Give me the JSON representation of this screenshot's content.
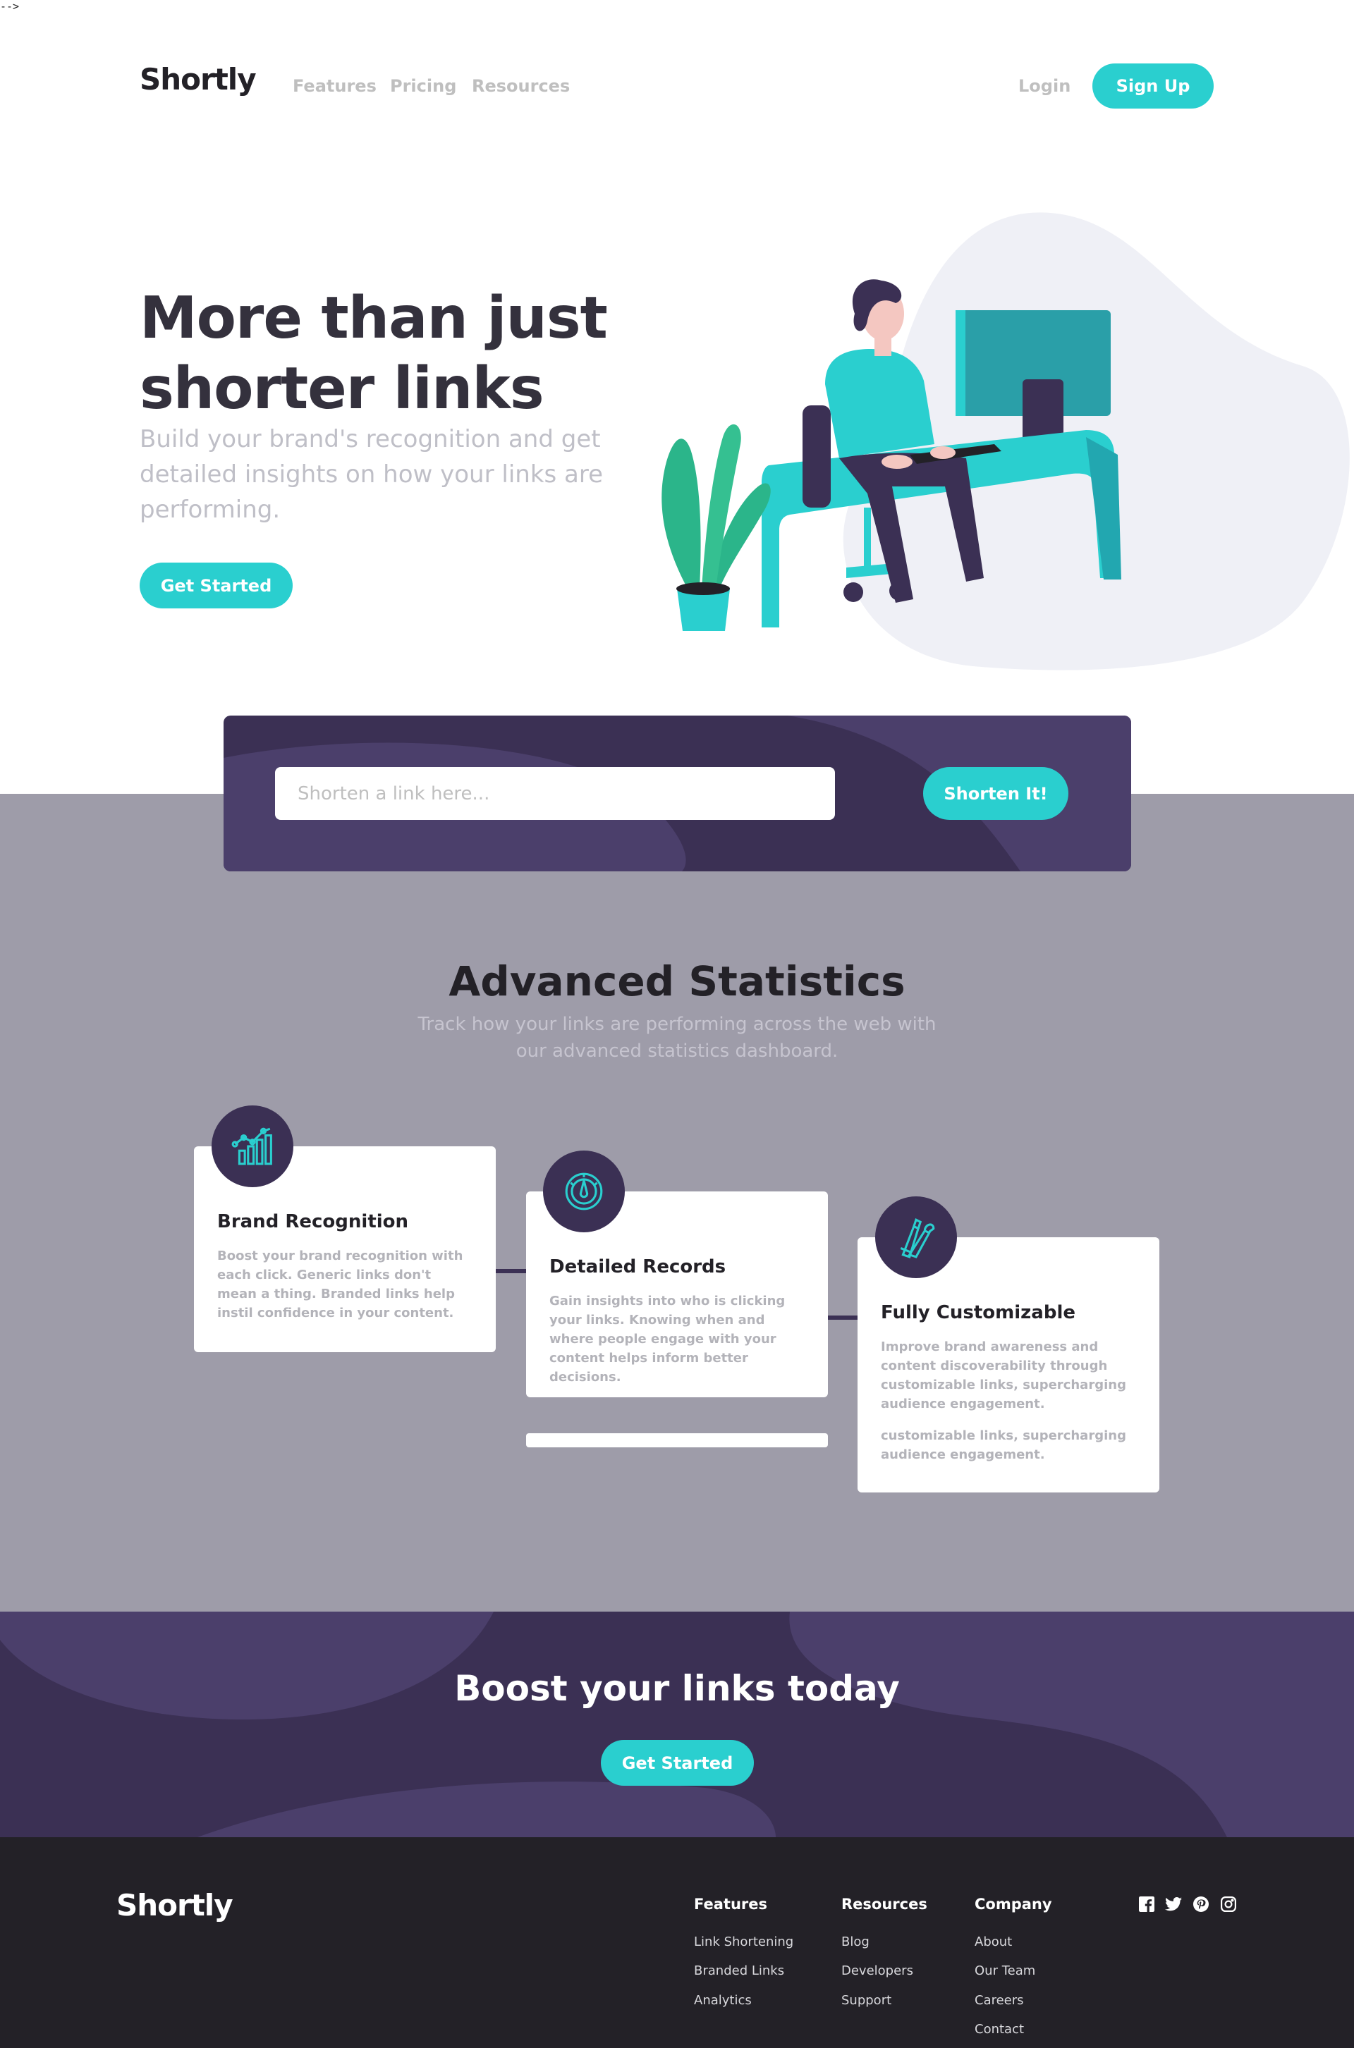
{
  "stray_text": "-->",
  "header": {
    "logo": "Shortly",
    "nav": [
      {
        "label": "Features"
      },
      {
        "label": "Pricing"
      },
      {
        "label": "Resources"
      }
    ],
    "login": "Login",
    "signup": "Sign Up"
  },
  "hero": {
    "title": "More than just shorter links",
    "text": "Build your brand's recognition and get detailed insights on how your links are performing.",
    "cta": "Get Started"
  },
  "shorten": {
    "placeholder": "Shorten a link here...",
    "button": "Shorten It!"
  },
  "stats": {
    "title": "Advanced Statistics",
    "subtitle": "Track how your links are performing across the web with our advanced statistics dashboard.",
    "cards": [
      {
        "title": "Brand Recognition",
        "text": "Boost your brand recognition with each click. Generic links don't mean a thing. Branded links help instil confidence in your content.",
        "icon": "brand-recognition-icon"
      },
      {
        "title": "Detailed Records",
        "text": "Gain insights into who is clicking your links. Knowing when and where people engage with your content helps inform better decisions.",
        "icon": "detailed-records-icon"
      },
      {
        "title": "Fully Customizable",
        "text": "Improve brand awareness and content discoverability through customizable links, supercharging audience engagement.",
        "extra": "customizable links, supercharging audience engagement.",
        "icon": "fully-customizable-icon"
      }
    ]
  },
  "boost": {
    "title": "Boost your links today",
    "cta": "Get Started"
  },
  "footer": {
    "logo": "Shortly",
    "columns": [
      {
        "title": "Features",
        "links": [
          "Link Shortening",
          "Branded Links",
          "Analytics"
        ]
      },
      {
        "title": "Resources",
        "links": [
          "Blog",
          "Developers",
          "Support"
        ]
      },
      {
        "title": "Company",
        "links": [
          "About",
          "Our Team",
          "Careers",
          "Contact"
        ]
      }
    ],
    "social": [
      "facebook-icon",
      "twitter-icon",
      "pinterest-icon",
      "instagram-icon"
    ]
  },
  "colors": {
    "cyan": "#2acfcf",
    "dark_violet": "#3b3054",
    "grayish_violet": "#9e9ca9",
    "very_dark_violet": "#232127",
    "gray": "#bfbfbf"
  }
}
